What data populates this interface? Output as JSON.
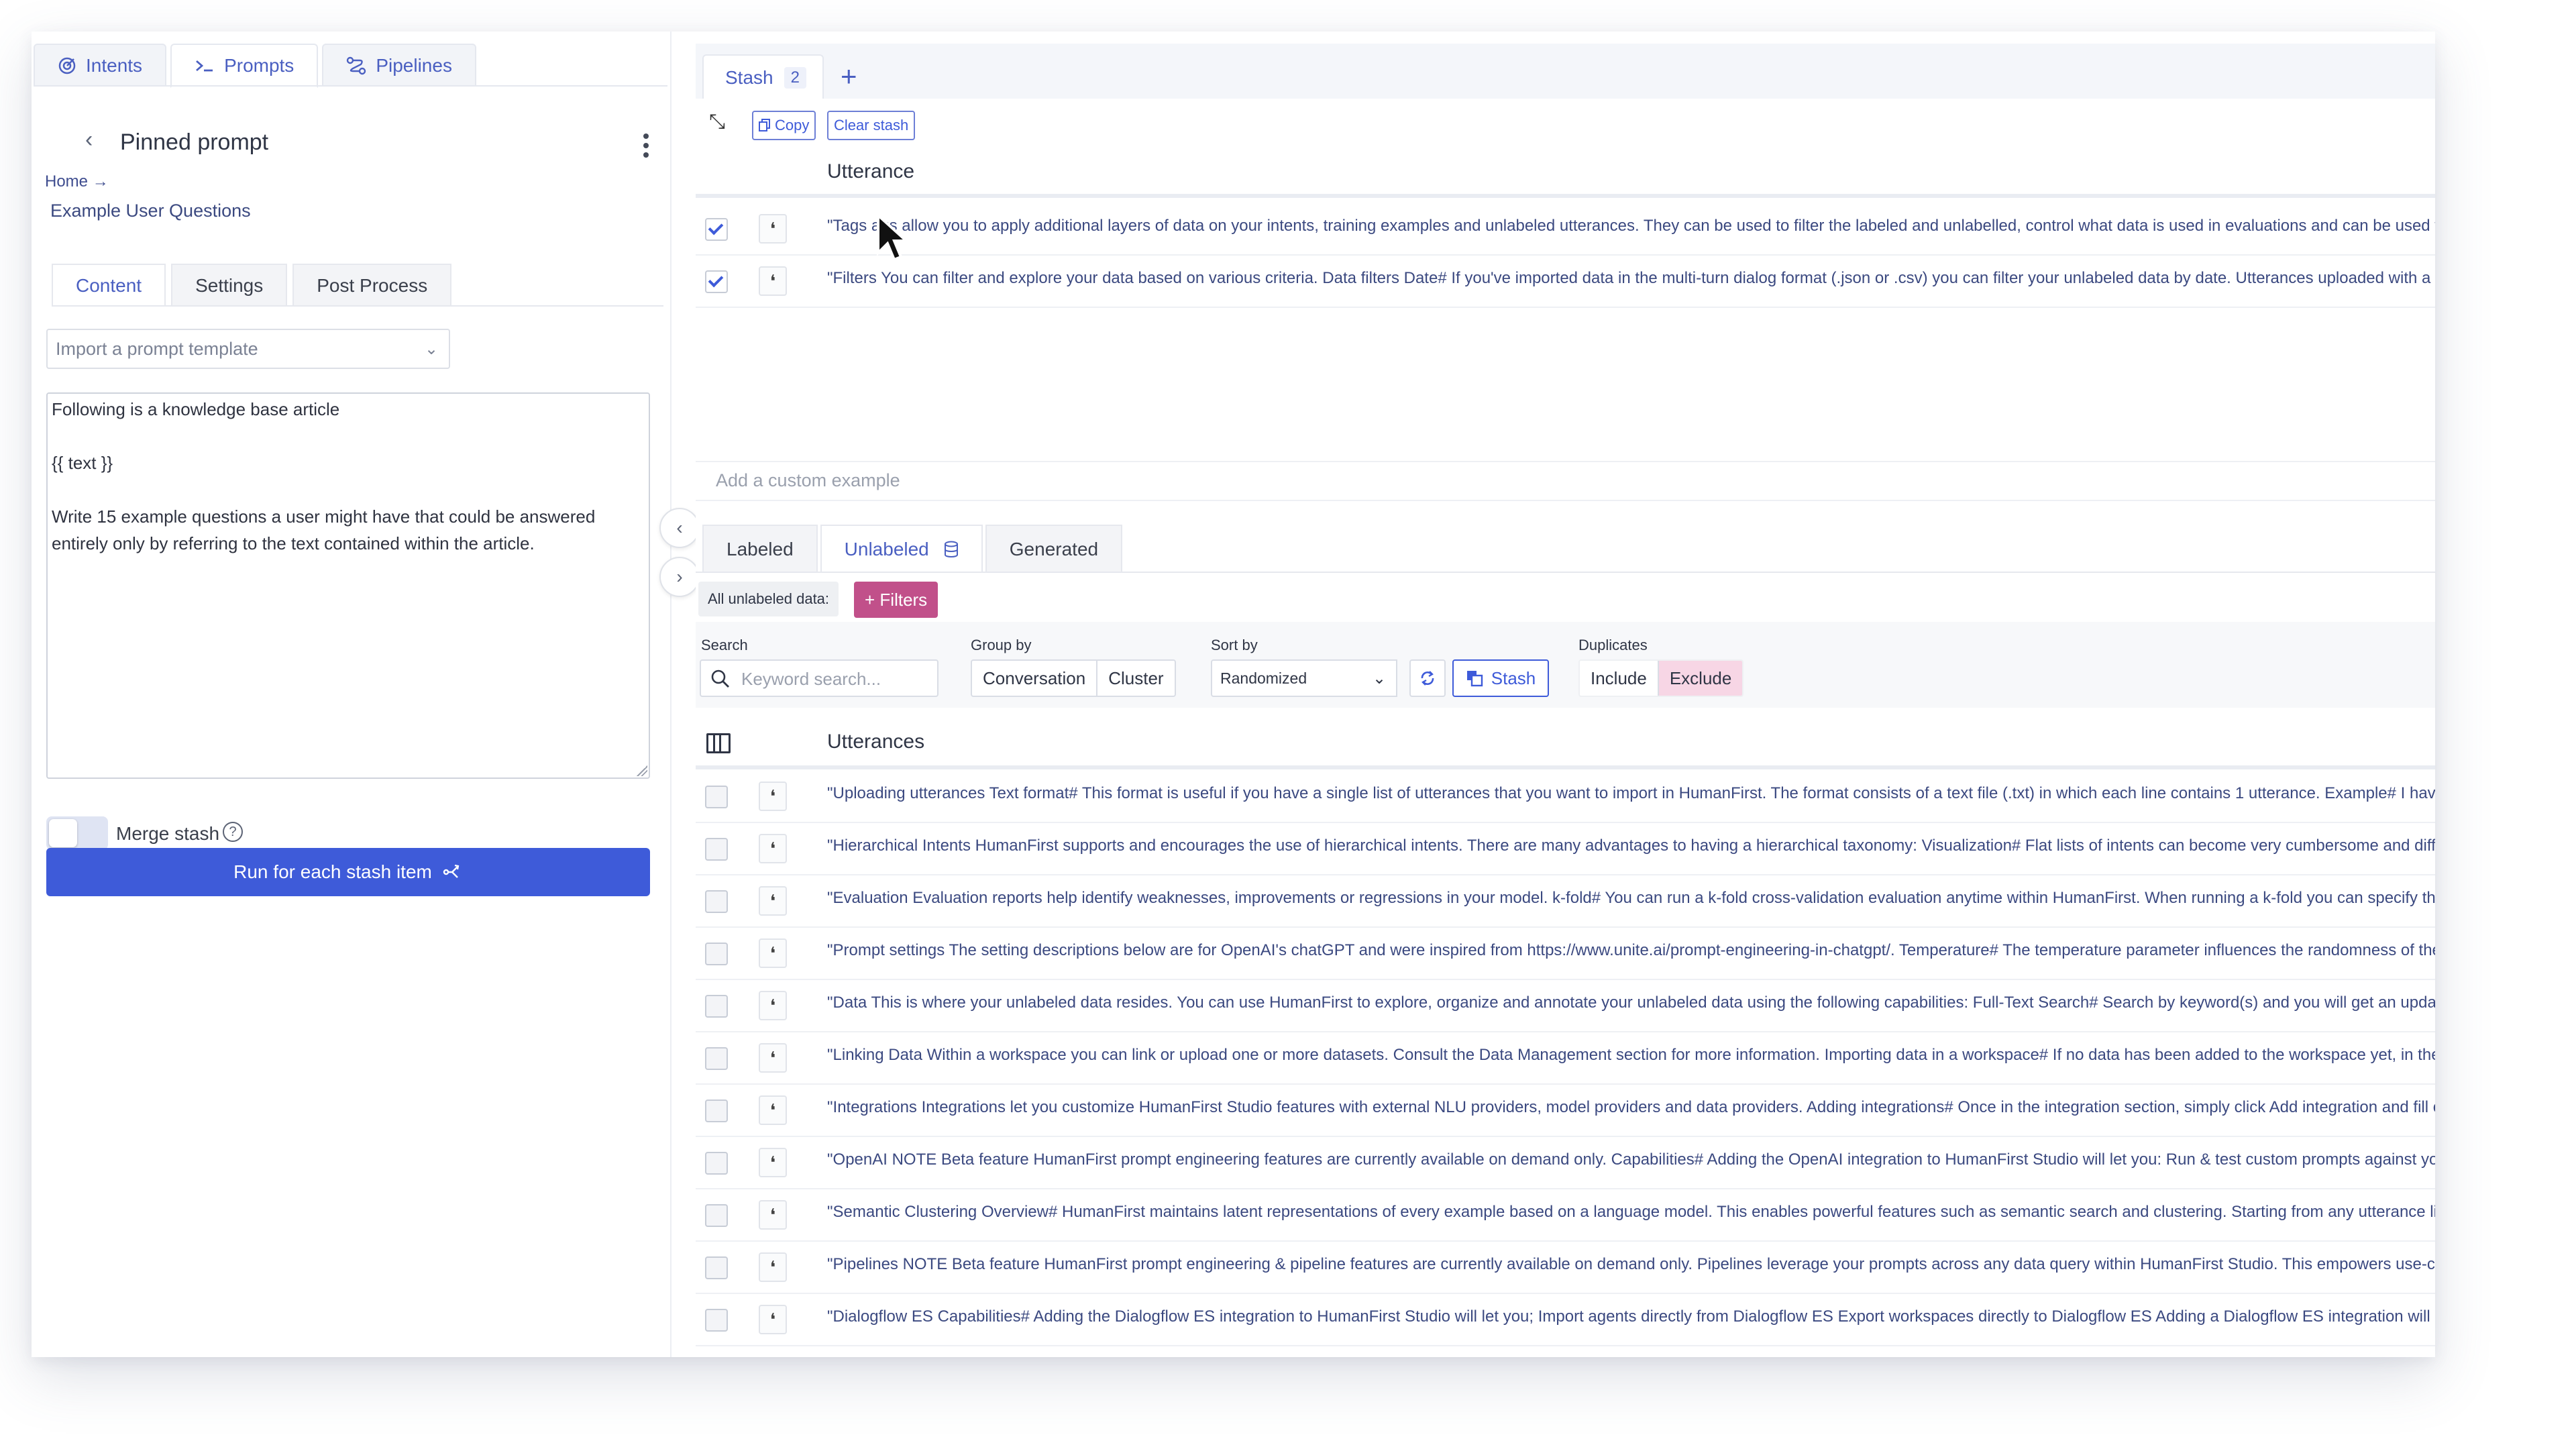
{
  "left": {
    "top_tabs": [
      {
        "label": "Intents",
        "icon": "target-icon"
      },
      {
        "label": "Prompts",
        "icon": "terminal-icon"
      },
      {
        "label": "Pipelines",
        "icon": "pipelines-icon"
      }
    ],
    "title": "Pinned prompt",
    "breadcrumb": "Home →",
    "breadcrumb_sub": "Example User Questions",
    "sub_tabs": [
      "Content",
      "Settings",
      "Post Process"
    ],
    "template_placeholder": "Import a prompt template",
    "prompt_lines": [
      "Following is a knowledge base article",
      "",
      "{{ text }}",
      "",
      "Write 15 example questions a user might have that could be answered",
      "entirely only by referring to the text contained within the article."
    ],
    "merge_label": "Merge stash",
    "run_label": "Run for each stash item"
  },
  "stash": {
    "tab_label": "Stash",
    "count": "2",
    "copy_label": "Copy",
    "clear_label": "Clear stash",
    "column": "Utterance",
    "rows": [
      {
        "checked": true,
        "text": "\"Tags  ags allow you to apply additional layers of data on your intents, training examples and unlabeled utterances. They can be used to filter the labeled and unlabelled, control what data is used in evaluations and can be used to annot"
      },
      {
        "checked": true,
        "text": "\"Filters You can filter and explore your data based on various criteria. Data filters Date# If you've imported data in the multi-turn dialog format (.json or .csv) you can filter your unlabeled data by date. Utterances uploaded with a text file (."
      }
    ],
    "custom_placeholder": "Add a custom example"
  },
  "data": {
    "tabs": [
      "Labeled",
      "Unlabeled",
      "Generated"
    ],
    "all_label": "All unlabeled data:",
    "filters_label": "+ Filters",
    "search_label": "Search",
    "search_placeholder": "Keyword search...",
    "group_label": "Group by",
    "group_options": [
      "Conversation",
      "Cluster"
    ],
    "sort_label": "Sort by",
    "sort_value": "Randomized",
    "stash_label": "Stash",
    "dup_label": "Duplicates",
    "dup_options": [
      "Include",
      "Exclude"
    ],
    "column": "Utterances",
    "rows": [
      "\"Uploading utterances Text format# This format is useful if you have a single list of utterances that you want to import in HumanFirst. The format consists of a text file (.txt) in which each line contains 1 utterance. Example# I have a probl",
      "\"Hierarchical Intents HumanFirst supports and encourages the use of hierarchical intents. There are many advantages to having a hierarchical taxonomy: Visualization# Flat lists of intents can become very cumbersome and difficult to vi",
      "\"Evaluation Evaluation reports help identify weaknesses, improvements or regressions in your model. k-fold# You can run a k-fold cross-validation evaluation anytime within HumanFirst. When running a k-fold you can specify the numbe",
      "\"Prompt settings The setting descriptions below are for OpenAI's chatGPT and were inspired from https://www.unite.ai/prompt-engineering-in-chatgpt/. Temperature# The temperature parameter influences the randomness of the AI's res",
      "\"Data This is where your unlabeled data resides. You can use HumanFirst to explore, organize and annotate your unlabeled data using the following capabilities: Full-Text Search# Search by keyword(s) and you will get an updated list o",
      "\"Linking Data Within a workspace you can link or upload one or more datasets. Consult the Data Management section for more information. Importing data in a workspace# If no data has been added to the workspace yet, in the Data se",
      "\"Integrations Integrations let you customize HumanFirst Studio features with external NLU providers, model providers and data providers. Adding integrations# Once in the integration section, simply click Add integration and fill out the re",
      "\"OpenAI NOTE Beta feature HumanFirst prompt engineering features are currently available on demand only. Capabilities# Adding the OpenAI integration to HumanFirst Studio will let you: Run & test custom prompts against your data F",
      "\"Semantic Clustering Overview# HumanFirst maintains latent representations of every example based on a language model. This enables powerful features such as semantic search and clustering. Starting from any utterance list (wheth",
      "\"Pipelines NOTE Beta feature HumanFirst prompt engineering & pipeline features are currently available on demand only. Pipelines leverage your prompts across any data query within HumanFirst Studio. This empowers use-cases req",
      "\"Dialogflow ES Capabilities# Adding the Dialogflow ES integration to HumanFirst Studio will let you; Import agents directly from Dialogflow ES Export workspaces directly to Dialogflow ES Adding a Dialogflow ES integration will require a"
    ]
  },
  "colors": {
    "accent": "#3e5bd9",
    "filters": "#c1508a",
    "exclude": "#f7d6e5"
  }
}
